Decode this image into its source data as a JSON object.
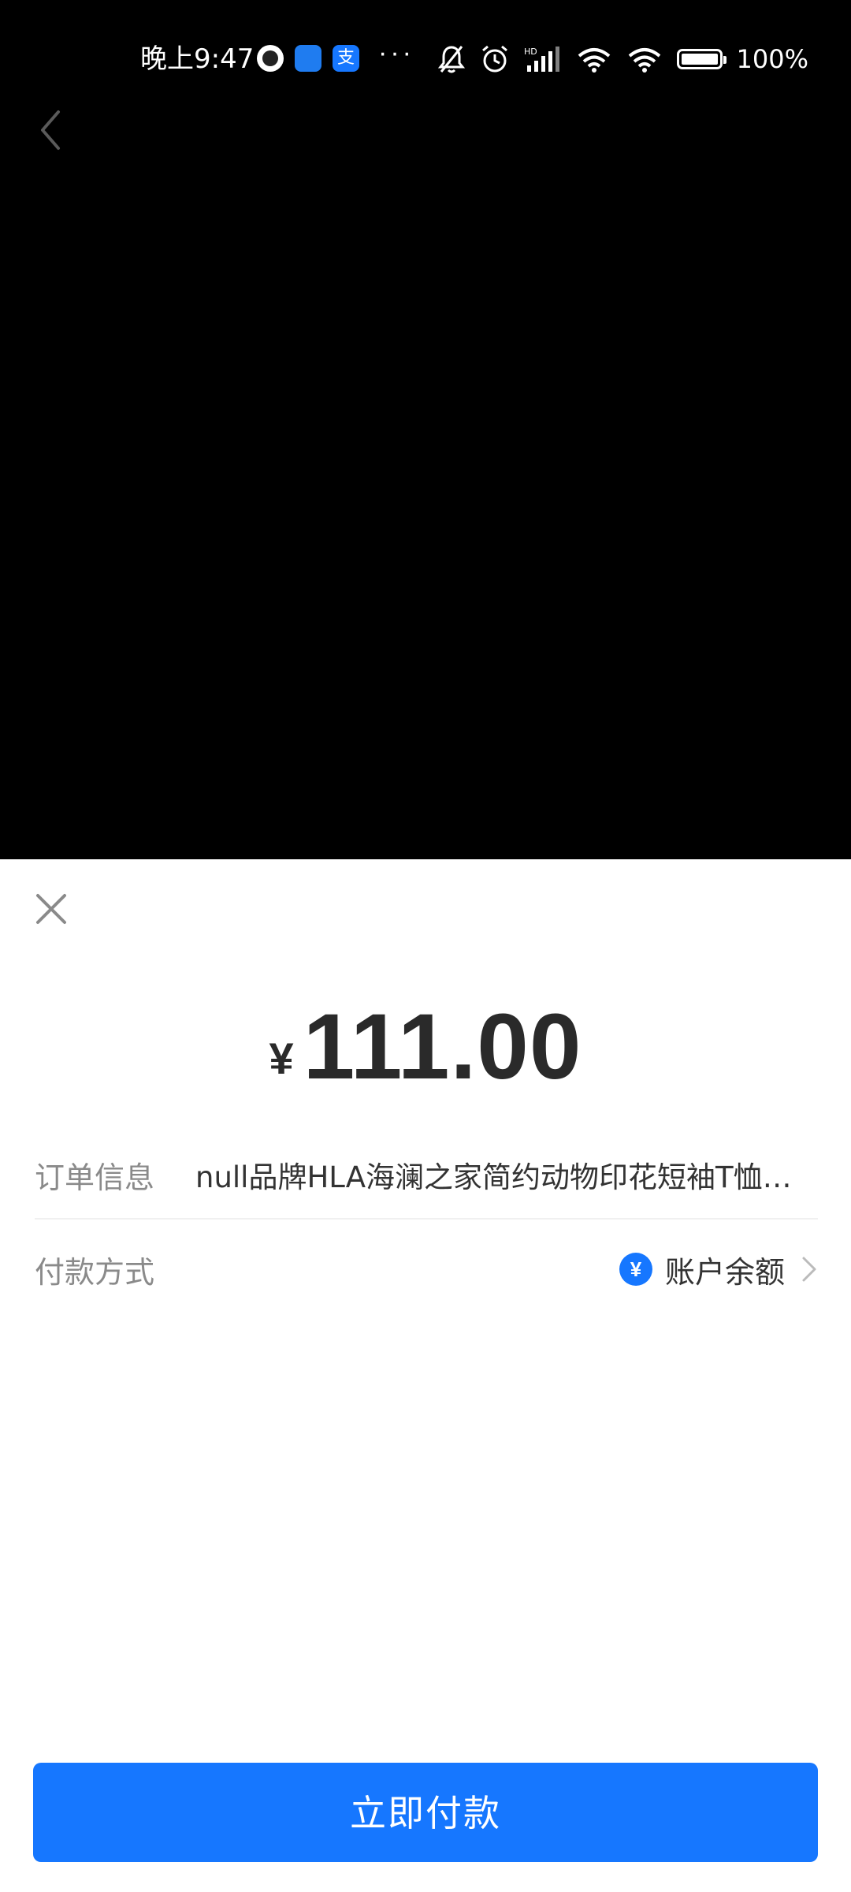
{
  "status_bar": {
    "time": "晚上9:47",
    "more": "···",
    "battery_pct": "100%",
    "icons": [
      "mute-icon",
      "alarm-icon",
      "signal-icon",
      "wifi-icon",
      "battery-icon"
    ],
    "app_icons": [
      "camera-app-icon",
      "autohome-app-icon",
      "alipay-app-icon"
    ],
    "alipay_glyph": "支"
  },
  "nav": {
    "back_icon": "chevron-left-icon"
  },
  "sheet": {
    "close_icon": "close-icon",
    "currency_symbol": "¥",
    "amount": "111.00",
    "order": {
      "label": "订单信息",
      "value": "null品牌HLA海澜之家简约动物印花短袖T恤男夏季新款透气运动休闲"
    },
    "payment": {
      "label": "付款方式",
      "badge": "¥",
      "method": "账户余额"
    },
    "pay_button_label": "立即付款"
  },
  "colors": {
    "accent": "#1677ff",
    "sheet_bg": "#ffffff",
    "top_bg": "#000000"
  }
}
